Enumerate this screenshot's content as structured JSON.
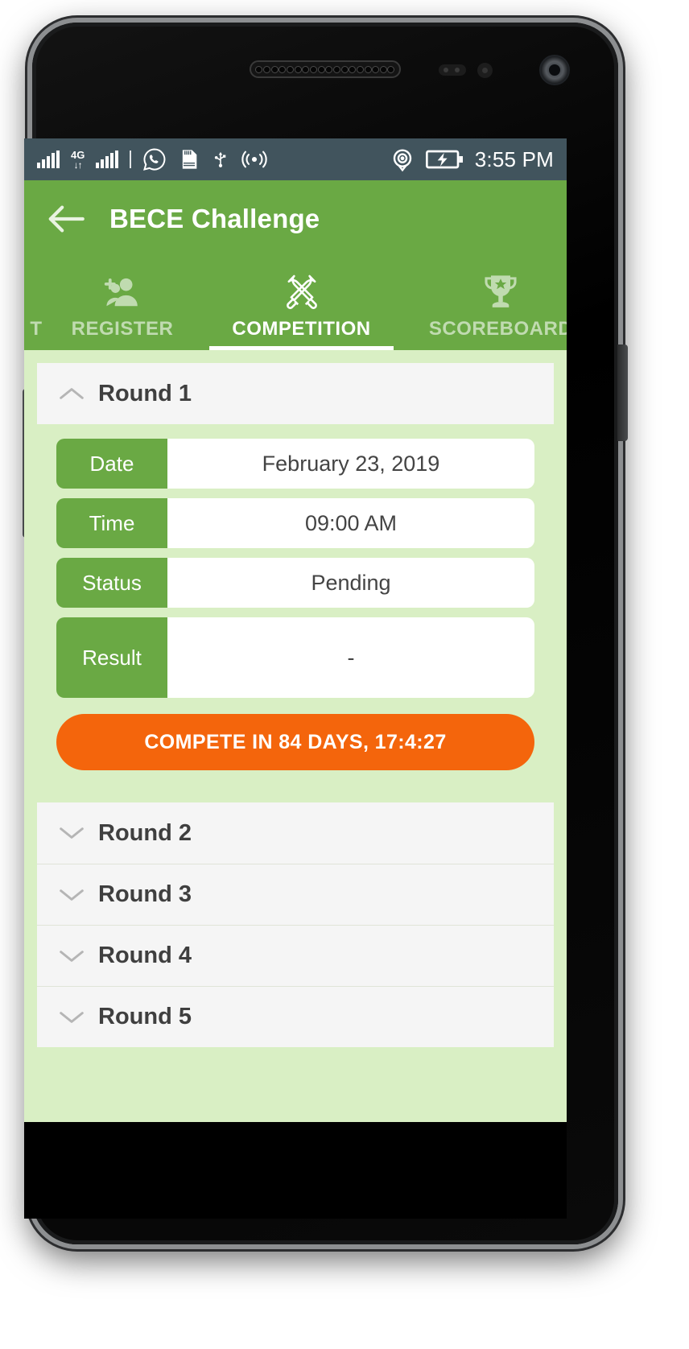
{
  "statusbar": {
    "time": "3:55 PM",
    "network_label": "4G",
    "icons": [
      "signal-bars-sim1",
      "4g-data-arrows",
      "signal-bars-sim2",
      "whatsapp-icon",
      "sd-card-icon",
      "usb-icon",
      "wifi-hotspot-icon",
      "location-icon",
      "battery-charging-icon"
    ],
    "bg_color": "#41545d"
  },
  "appbar": {
    "title": "BECE Challenge",
    "back_label": "Back",
    "bg_color": "#6aa944"
  },
  "tabs": {
    "cut_off_left_label": "T",
    "items": [
      {
        "label": "REGISTER",
        "icon": "add-person-icon",
        "active": false
      },
      {
        "label": "COMPETITION",
        "icon": "crossed-swords-icon",
        "active": true
      },
      {
        "label": "SCOREBOARD",
        "icon": "trophy-icon",
        "active": false
      }
    ]
  },
  "expanded_round": {
    "title": "Round 1",
    "chevron": "chevron-up-icon",
    "fields": [
      {
        "key": "Date",
        "value": "February 23, 2019"
      },
      {
        "key": "Time",
        "value": "09:00 AM"
      },
      {
        "key": "Status",
        "value": "Pending"
      },
      {
        "key": "Result",
        "value": "-"
      }
    ],
    "action_button": {
      "label": "COMPETE IN 84 DAYS, 17:4:27",
      "color": "#f4650c"
    }
  },
  "collapsed_rounds": [
    {
      "title": "Round 2",
      "chevron": "chevron-down-icon"
    },
    {
      "title": "Round 3",
      "chevron": "chevron-down-icon"
    },
    {
      "title": "Round 4",
      "chevron": "chevron-down-icon"
    },
    {
      "title": "Round 5",
      "chevron": "chevron-down-icon"
    }
  ],
  "theme": {
    "primary_green": "#6aa944",
    "background_green": "#d9efc4",
    "panel_grey": "#f5f5f5",
    "accent_orange": "#f4650c"
  }
}
